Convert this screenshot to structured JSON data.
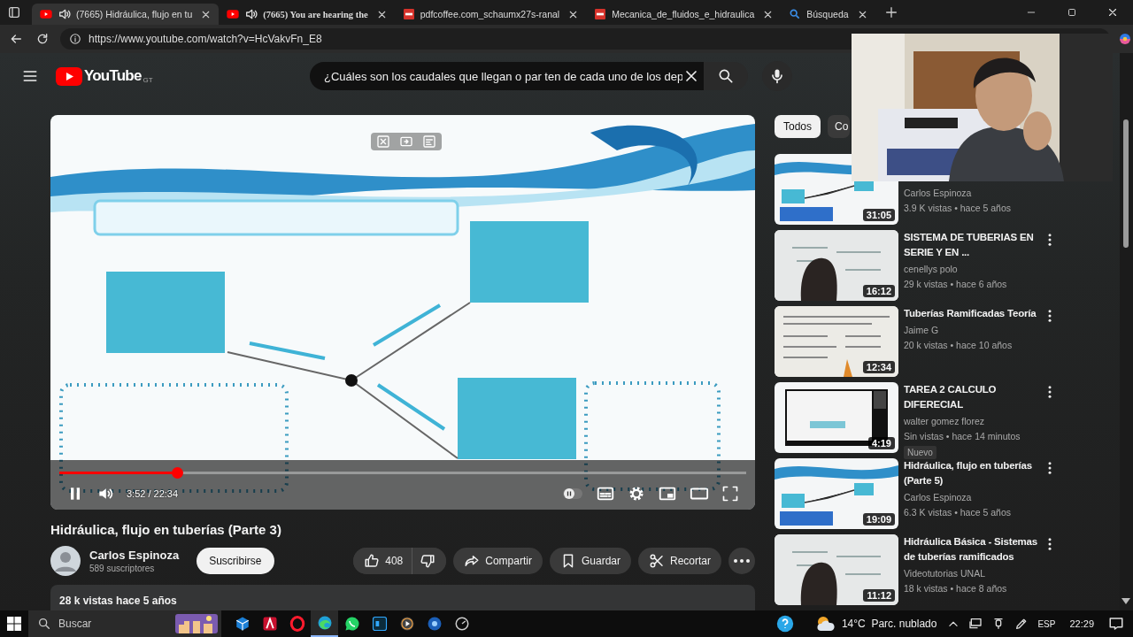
{
  "browser": {
    "tabs": [
      {
        "kind": "youtube",
        "audio": true,
        "title": "(7665) Hidráulica, flujo en tu",
        "selected": true
      },
      {
        "kind": "youtube",
        "audio": true,
        "title": "(7665) You are hearing the",
        "selected": false
      },
      {
        "kind": "pdf",
        "audio": false,
        "title": "pdfcoffee.com_schaumx27s-ranal",
        "selected": false
      },
      {
        "kind": "pdf",
        "audio": false,
        "title": "Mecanica_de_fluidos_e_hidraulica",
        "selected": false
      },
      {
        "kind": "search",
        "audio": false,
        "title": "Búsqueda",
        "selected": false
      }
    ],
    "url": "https://www.youtube.com/watch?v=HcVakvFn_E8"
  },
  "header": {
    "logo": "YouTube",
    "country": "GT",
    "search_value": "¿Cuáles son los caudales que llegan o par ten de cada uno de los dep"
  },
  "player": {
    "time": "3:52 / 22:34",
    "level": 0.171
  },
  "video": {
    "title": "Hidráulica, flujo en tuberías (Parte 3)",
    "channel": "Carlos Espinoza",
    "subscribers": "589 suscriptores",
    "subscribe": "Suscribirse",
    "likes": "408",
    "actions": [
      {
        "kind": "share",
        "label": "Compartir"
      },
      {
        "kind": "save",
        "label": "Guardar"
      },
      {
        "kind": "clip",
        "label": "Recortar"
      }
    ],
    "description": "28 k vistas  hace 5 años"
  },
  "sidebar": {
    "chips": [
      {
        "label": "Todos",
        "selected": true
      },
      {
        "label": "Co",
        "selected": false
      }
    ],
    "recommendations": [
      {
        "channel": "Carlos Espinoza",
        "meta": "3.9 K vistas • hace 5 años",
        "duration": "31:05"
      },
      {
        "title": "SISTEMA DE TUBERIAS EN SERIE Y EN ...",
        "channel": "cenellys polo",
        "meta": "29 k vistas • hace 6 años",
        "duration": "16:12"
      },
      {
        "title": "Tuberías Ramificadas Teoría",
        "channel": "Jaime G",
        "meta": "20 k vistas • hace 10 años",
        "duration": "12:34"
      },
      {
        "title": "TAREA 2 CALCULO DIFERECIAL",
        "channel": "walter gomez florez",
        "meta": "Sin vistas • hace 14 minutos",
        "badge": "Nuevo",
        "duration": "4:19"
      },
      {
        "title": "Hidráulica, flujo en tuberías (Parte 5)",
        "channel": "Carlos Espinoza",
        "meta": "6.3 K vistas • hace 5 años",
        "duration": "19:09"
      },
      {
        "title": "Hidráulica Básica - Sistemas de tuberías ramificados",
        "channel": "Videotutorias UNAL",
        "meta": "18 k vistas • hace 8 años",
        "duration": "11:12"
      }
    ]
  },
  "taskbar": {
    "search_placeholder": "Buscar",
    "weather": "14°C  Parc. nublado",
    "language": "ESP",
    "clock": "22:29"
  }
}
